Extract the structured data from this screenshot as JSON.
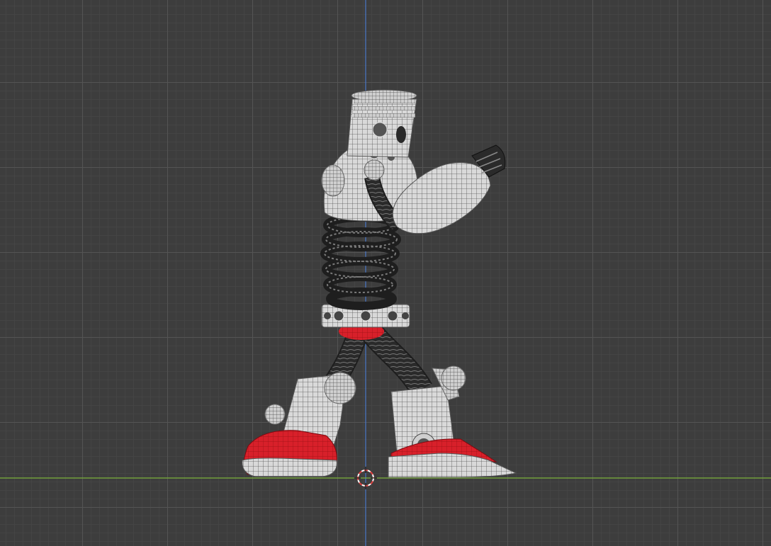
{
  "viewport": {
    "background_color": "#3d3d3d",
    "grid_minor_color": "#464646",
    "grid_major_color": "#555555",
    "x_axis_color": "#7bb23c",
    "z_axis_color": "#4a78c8",
    "cursor_color": "#e04040"
  },
  "object": {
    "name": "robot-wireframe-model",
    "accent_color": "#d8202a",
    "surface_color": "#d9d9d9",
    "coil_color": "#222222"
  }
}
